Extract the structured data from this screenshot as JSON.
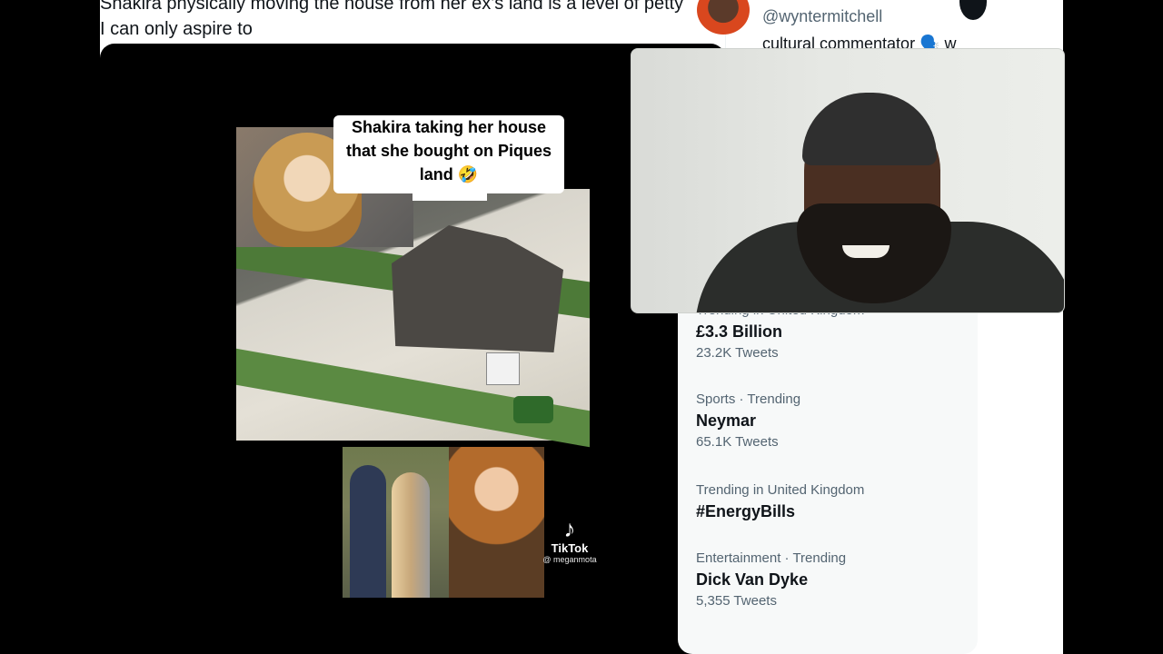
{
  "tweet": {
    "line1": "Shakira physically moving the house from her ex’s land is a level of petty",
    "line2": "I can only aspire to"
  },
  "media": {
    "caption_line1": "Shakira taking her house",
    "caption_line2": "that she bought on Piques",
    "caption_line3": "land 🤣",
    "tiktok_icon": "♪",
    "tiktok_label": "TikTok",
    "tiktok_handle": "@ meganmota"
  },
  "account": {
    "handle": "@wyntermitchell",
    "bio": "cultural commentator 🗣️ w"
  },
  "trends": [
    {
      "meta": "Trending in United Kingdom",
      "name": "£3.3 Billion",
      "count": "23.2K Tweets"
    },
    {
      "meta": "Sports · Trending",
      "name": "Neymar",
      "count": "65.1K Tweets"
    },
    {
      "meta": "Trending in United Kingdom",
      "name": "#EnergyBills",
      "count": ""
    },
    {
      "meta": "Entertainment · Trending",
      "name": "Dick Van Dyke",
      "count": "5,355 Tweets"
    }
  ]
}
